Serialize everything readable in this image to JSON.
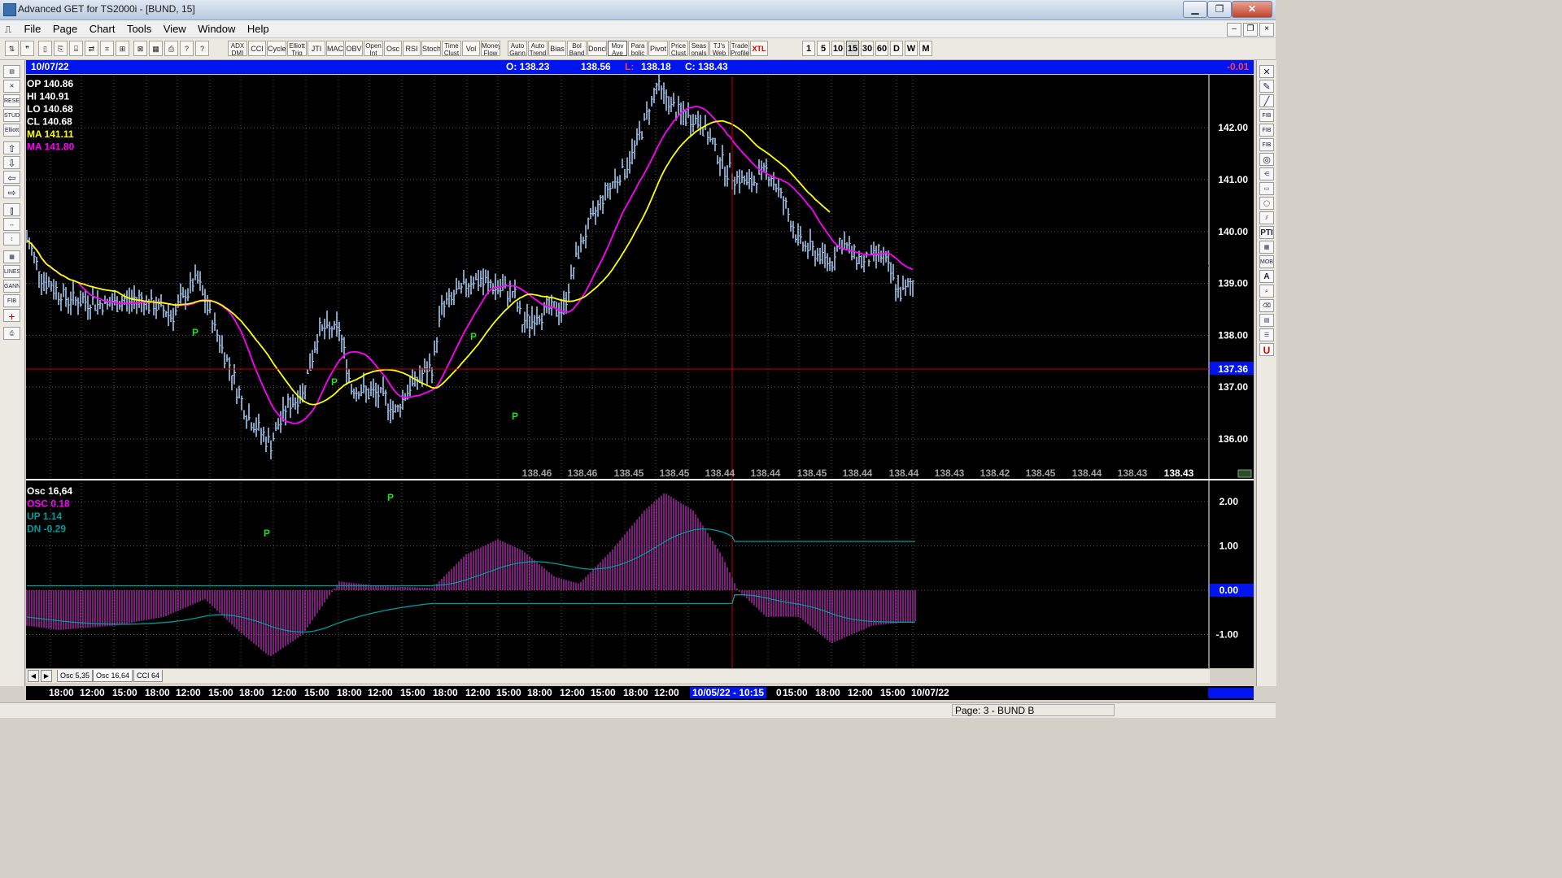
{
  "window": {
    "title": "Advanced GET for TS2000i - [BUND, 15]",
    "min": "▁",
    "max": "❐",
    "close": "✕"
  },
  "menu": [
    "File",
    "Page",
    "Chart",
    "Tools",
    "View",
    "Window",
    "Help"
  ],
  "toolbar": {
    "studies": [
      "ADX DMI",
      "CCI",
      "Cycles",
      "Elliott Trig",
      "JTI",
      "MACD",
      "OBV",
      "Open Int",
      "Osc",
      "RSI",
      "Stoch",
      "Time Clust",
      "Vol",
      "Money Flow",
      "Auto Gann",
      "Auto Trend",
      "Bias",
      "Bol Band",
      "Donch",
      "Mov Ave",
      "Para bolic",
      "Pivot",
      "Price Clust",
      "Seas onals",
      "TJ's Web",
      "Trade Profile",
      "XTL"
    ],
    "timeframes": [
      "1",
      "5",
      "10",
      "15",
      "30",
      "60",
      "D",
      "W",
      "M"
    ],
    "selected_tf": "15"
  },
  "infobar": {
    "date": "10/07/22",
    "open": "O: 138.23",
    "high": "138.56",
    "low_label": "L:",
    "low": "138.18",
    "close": "C: 138.43",
    "change": "-0.01"
  },
  "price_legend": [
    {
      "label": "OP",
      "value": "140.86",
      "color": "#ffffff"
    },
    {
      "label": "HI",
      "value": "140.91",
      "color": "#ffffff"
    },
    {
      "label": "LO",
      "value": "140.68",
      "color": "#ffffff"
    },
    {
      "label": "CL",
      "value": "140.68",
      "color": "#ffffff"
    },
    {
      "label": "MA",
      "value": "141.11",
      "color": "#ffff00"
    },
    {
      "label": "MA",
      "value": "141.80",
      "color": "#ff00ff"
    }
  ],
  "price_axis": [
    "142.00",
    "141.00",
    "140.00",
    "139.00",
    "138.00",
    "137.00",
    "136.00"
  ],
  "crosshair_price": "137.36",
  "bottom_values": [
    "138.46",
    "138.46",
    "138.45",
    "138.45",
    "138.44",
    "138.44",
    "138.45",
    "138.44",
    "138.44",
    "138.43",
    "138.42",
    "138.45",
    "138.44",
    "138.43",
    "138.43"
  ],
  "pivot_label": "P",
  "osc_legend": [
    {
      "label": "Osc 16,64",
      "value": "",
      "color": "#ffffff"
    },
    {
      "label": "OSC",
      "value": "0.18",
      "color": "#ff00ff"
    },
    {
      "label": "UP",
      "value": "1.14",
      "color": "#009c9c"
    },
    {
      "label": "DN",
      "value": "-0.29",
      "color": "#009c9c"
    }
  ],
  "osc_axis": [
    "2.00",
    "1.00",
    "0.00",
    "-1.00"
  ],
  "tabs": [
    "Osc 5,35",
    "Osc 16,64",
    "CCI 64"
  ],
  "selected_tab": "Osc 16,64",
  "time_axis": [
    "18:00",
    "12:00",
    "15:00",
    "18:00",
    "12:00",
    "15:00",
    "18:00",
    "12:00",
    "15:00",
    "18:00",
    "12:00",
    "15:00",
    "18:00",
    "12:00",
    "15:00",
    "18:00",
    "12:00",
    "15:00",
    "18:00",
    "12:00",
    "10/05/22 - 10:15",
    "0",
    "15:00",
    "18:00",
    "12:00",
    "15:00",
    "10/07/22"
  ],
  "status": "Page: 3 - BUND B",
  "colors": {
    "bars": "#9fc5ec",
    "ma_fast": "#ffff00",
    "ma_slow": "#ff00ff",
    "osc_hist": "#cc33cc",
    "osc_bands": "#009c9c",
    "crosshair": "#cc0000",
    "pivot": "#22dd22",
    "infobar": "#0014f0"
  },
  "left_tools": [
    "open-icon",
    "gann-icon",
    "reset-icon",
    "study-icon",
    "elliott-icon",
    "arrow-up-icon",
    "arrow-down-icon",
    "arrow-left-icon",
    "arrow-right-icon",
    "bars-icon",
    "zoom-h-icon",
    "zoom-v-icon",
    "grid-icon",
    "lines-icon",
    "gann-fan-icon",
    "fib-icon",
    "cross-icon",
    "print-icon"
  ],
  "right_tools": [
    "close-x-icon",
    "pencil-icon",
    "line-icon",
    "fib-ret-icon",
    "fib-ext-icon",
    "fib-time-icon",
    "circle-icon",
    "fan-icon",
    "box-icon",
    "ellipse-icon",
    "channel-icon",
    "pti-icon",
    "grid-icon",
    "mob-icon",
    "text-icon",
    "magnify-icon",
    "eraser-icon",
    "table-icon",
    "list-icon",
    "u-icon"
  ],
  "right_tool_labels": {
    "fib_ret": "FIB RET",
    "fib_ext": "FIB EXT",
    "fib_time": "FIB TIME",
    "pti": "PTI",
    "mob": "MOB",
    "text": "A",
    "u": "U"
  },
  "left_tool_labels": {
    "reset": "RESET",
    "study": "STUDY",
    "elliott": "Elliott",
    "lines": "LINES",
    "gann": "GANN",
    "fib": "FIB"
  }
}
